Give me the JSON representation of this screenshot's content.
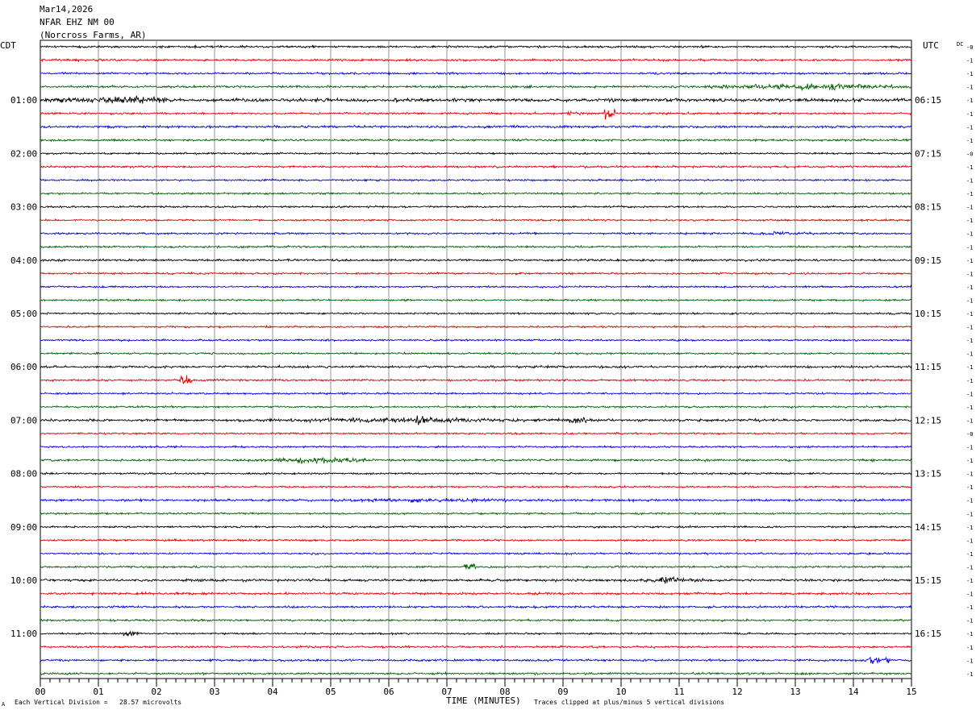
{
  "header": {
    "date": "Mar14,2026",
    "station": "NFAR EHZ NM 00",
    "location": "(Norcross Farms, AR)"
  },
  "left_axis_title": "CDT",
  "right_axis_title": "UTC",
  "dc_title": "DC",
  "footer": {
    "scale_note": "Each Vertical Division =   28.57 microvolts",
    "clip_note": "Traces clipped at plus/minus 5 vertical divisions",
    "corner_mark": "A"
  },
  "chart_data": {
    "type": "line",
    "subtype": "helicorder",
    "xlabel": "TIME (MINUTES)",
    "xlim": [
      0,
      15
    ],
    "x_ticks": [
      "00",
      "01",
      "02",
      "03",
      "04",
      "05",
      "06",
      "07",
      "08",
      "09",
      "10",
      "11",
      "12",
      "13",
      "14",
      "15"
    ],
    "grid": "vertical lines every 1 minute",
    "row_count": 48,
    "row_colors": [
      "#000000",
      "#e00000",
      "#0000e0",
      "#006000"
    ],
    "left_hour_labels": [
      {
        "row": 4,
        "label": "01:00"
      },
      {
        "row": 8,
        "label": "02:00"
      },
      {
        "row": 12,
        "label": "03:00"
      },
      {
        "row": 16,
        "label": "04:00"
      },
      {
        "row": 20,
        "label": "05:00"
      },
      {
        "row": 24,
        "label": "06:00"
      },
      {
        "row": 28,
        "label": "07:00"
      },
      {
        "row": 32,
        "label": "08:00"
      },
      {
        "row": 36,
        "label": "09:00"
      },
      {
        "row": 40,
        "label": "10:00"
      },
      {
        "row": 44,
        "label": "11:00"
      }
    ],
    "right_hour_labels": [
      {
        "row": 4,
        "label": "06:15"
      },
      {
        "row": 8,
        "label": "07:15"
      },
      {
        "row": 12,
        "label": "08:15"
      },
      {
        "row": 16,
        "label": "09:15"
      },
      {
        "row": 20,
        "label": "10:15"
      },
      {
        "row": 24,
        "label": "11:15"
      },
      {
        "row": 28,
        "label": "12:15"
      },
      {
        "row": 32,
        "label": "13:15"
      },
      {
        "row": 36,
        "label": "14:15"
      },
      {
        "row": 40,
        "label": "15:15"
      },
      {
        "row": 44,
        "label": "16:15"
      }
    ],
    "dc_offsets": [
      "-0",
      "-1",
      "-1",
      "-1",
      "-1",
      "-1",
      "-1",
      "-1",
      "-0",
      "-1",
      "-1",
      "-1",
      "-1",
      "-1",
      "-1",
      "-1",
      "-1",
      "-1",
      "-1",
      "-1",
      "-1",
      "-1",
      "-1",
      "-1",
      "-1",
      "-1",
      "-1",
      "-1",
      "-1",
      "-0",
      "-1",
      "-1",
      "-1",
      "-1",
      "-1",
      "-1",
      "-1",
      "-1",
      "-1",
      "-1",
      "-1",
      "-1",
      "-1",
      "-1",
      "-1",
      "-1",
      "-1",
      "-1"
    ],
    "row_noise_amplitude": [
      1.5,
      1.5,
      1.5,
      1.6,
      2.4,
      1.4,
      1.6,
      1.4,
      1.3,
      1.4,
      1.3,
      1.3,
      1.3,
      1.3,
      1.4,
      1.4,
      1.5,
      1.4,
      1.3,
      1.3,
      1.3,
      1.3,
      1.3,
      1.3,
      1.6,
      1.4,
      1.3,
      1.3,
      1.8,
      1.3,
      1.3,
      1.5,
      1.3,
      1.3,
      1.6,
      1.3,
      1.3,
      1.3,
      1.3,
      1.4,
      1.7,
      1.6,
      1.5,
      1.4,
      1.3,
      1.5,
      1.5,
      1.4
    ],
    "events": [
      {
        "row": 3,
        "start": 11.3,
        "end": 15.0,
        "amp": 5
      },
      {
        "row": 4,
        "start": 0.0,
        "end": 2.5,
        "amp": 6
      },
      {
        "row": 5,
        "start": 9.7,
        "end": 9.9,
        "amp": 9
      },
      {
        "row": 5,
        "start": 9.0,
        "end": 9.4,
        "amp": 3
      },
      {
        "row": 14,
        "start": 12.0,
        "end": 13.5,
        "amp": 3
      },
      {
        "row": 25,
        "start": 2.4,
        "end": 2.6,
        "amp": 6
      },
      {
        "row": 28,
        "start": 3.0,
        "end": 9.5,
        "amp": 4
      },
      {
        "row": 28,
        "start": 6.3,
        "end": 6.8,
        "amp": 7
      },
      {
        "row": 28,
        "start": 9.0,
        "end": 9.5,
        "amp": 6
      },
      {
        "row": 31,
        "start": 3.8,
        "end": 5.8,
        "amp": 5
      },
      {
        "row": 34,
        "start": 4.0,
        "end": 9.5,
        "amp": 3
      },
      {
        "row": 39,
        "start": 7.3,
        "end": 7.5,
        "amp": 5
      },
      {
        "row": 40,
        "start": 10.3,
        "end": 11.5,
        "amp": 5
      },
      {
        "row": 44,
        "start": 1.4,
        "end": 1.7,
        "amp": 6
      },
      {
        "row": 46,
        "start": 14.1,
        "end": 14.7,
        "amp": 6
      }
    ]
  }
}
